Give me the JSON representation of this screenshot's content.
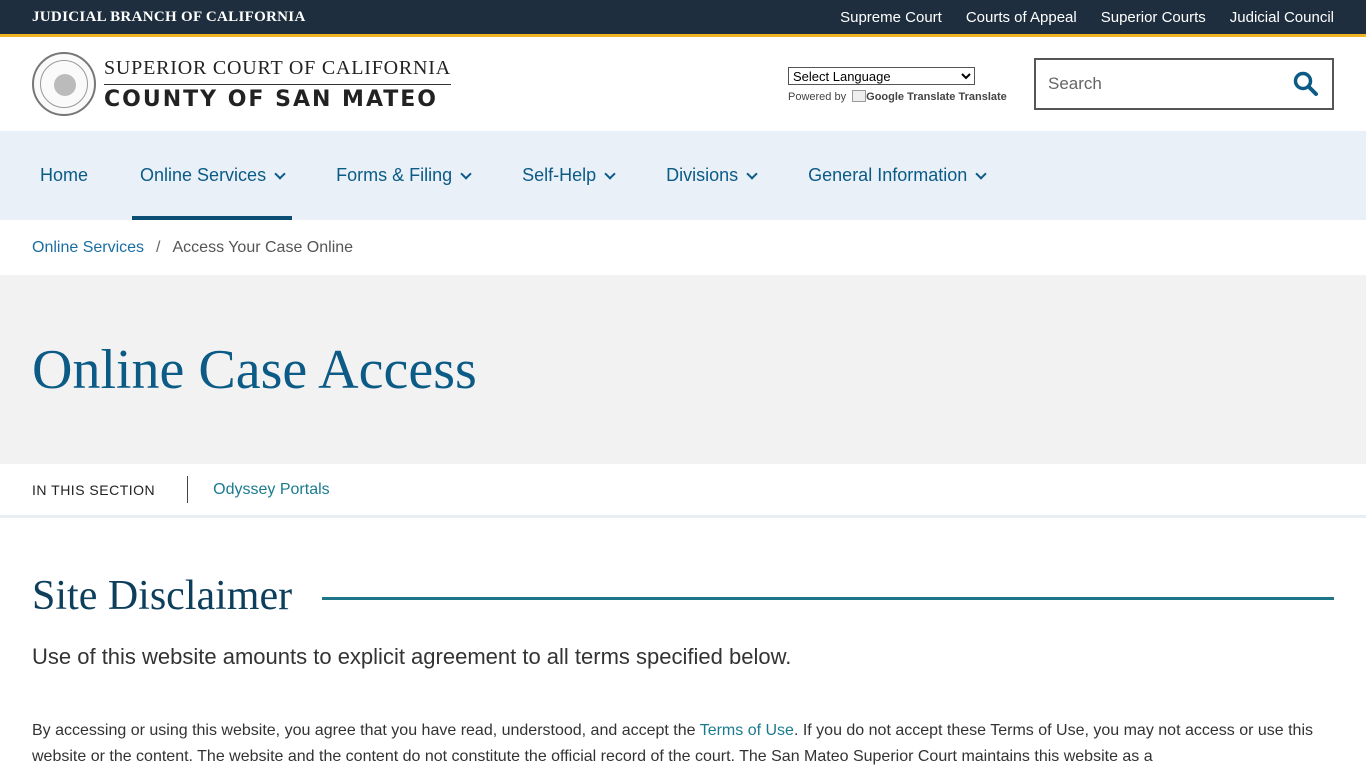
{
  "topbar": {
    "branch": "JUDICIAL BRANCH OF CALIFORNIA",
    "links": [
      "Supreme Court",
      "Courts of Appeal",
      "Superior Courts",
      "Judicial Council"
    ]
  },
  "header": {
    "logo_line1": "SUPERIOR COURT OF CALIFORNIA",
    "logo_line2": "COUNTY OF SAN MATEO",
    "language_select": "Select Language",
    "powered_by": "Powered by",
    "google_translate": "Google Translate",
    "translate": "Translate",
    "search_placeholder": "Search"
  },
  "nav": {
    "items": [
      {
        "label": "Home",
        "dropdown": false
      },
      {
        "label": "Online Services",
        "dropdown": true,
        "active": true
      },
      {
        "label": "Forms & Filing",
        "dropdown": true
      },
      {
        "label": "Self-Help",
        "dropdown": true
      },
      {
        "label": "Divisions",
        "dropdown": true
      },
      {
        "label": "General Information",
        "dropdown": true
      }
    ]
  },
  "breadcrumb": {
    "parent": "Online Services",
    "separator": "/",
    "current": "Access Your Case Online"
  },
  "hero": {
    "title": "Online Case Access"
  },
  "section_nav": {
    "label": "IN THIS SECTION",
    "links": [
      "Odyssey Portals"
    ]
  },
  "content": {
    "heading": "Site Disclaimer",
    "lead": "Use of this website amounts to explicit agreement to all terms specified below.",
    "para_before_link": "By accessing or using this website, you agree that you have read, understood, and accept the ",
    "para_link": "Terms of Use",
    "para_after_link": ".  If you do not accept these Terms of Use, you may not access or use this website or the content. The website and the content do not constitute the official record of the court. The San Mateo Superior Court maintains this website as a"
  },
  "colors": {
    "topbar_bg": "#1e2e3e",
    "topbar_accent": "#f0b323",
    "nav_bg": "#e9f0f7",
    "link_blue": "#0b5b86",
    "heading_navy": "#0d3e5c"
  }
}
